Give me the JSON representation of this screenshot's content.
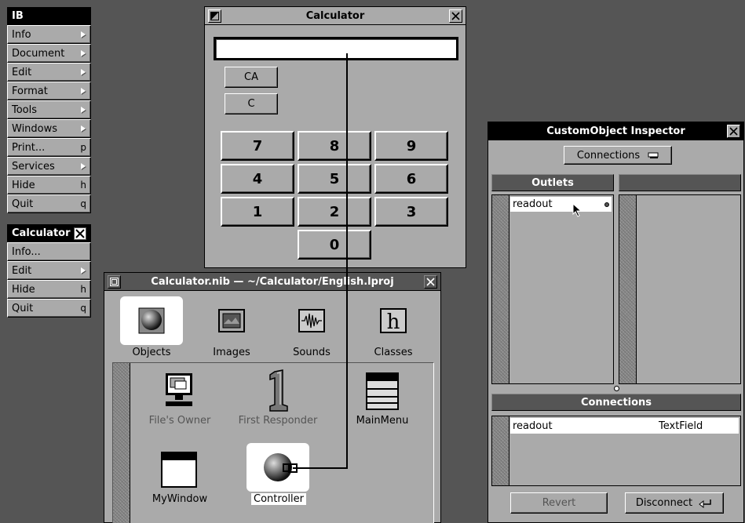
{
  "ib_menu": {
    "title": "IB",
    "items": [
      {
        "label": "Info",
        "key": "",
        "submenu": true
      },
      {
        "label": "Document",
        "key": "",
        "submenu": true
      },
      {
        "label": "Edit",
        "key": "",
        "submenu": true
      },
      {
        "label": "Format",
        "key": "",
        "submenu": true
      },
      {
        "label": "Tools",
        "key": "",
        "submenu": true
      },
      {
        "label": "Windows",
        "key": "",
        "submenu": true
      },
      {
        "label": "Print...",
        "key": "p",
        "submenu": false
      },
      {
        "label": "Services",
        "key": "",
        "submenu": true
      },
      {
        "label": "Hide",
        "key": "h",
        "submenu": false
      },
      {
        "label": "Quit",
        "key": "q",
        "submenu": false
      }
    ]
  },
  "calc_menu": {
    "title": "Calculator",
    "items": [
      {
        "label": "Info...",
        "key": "",
        "submenu": false
      },
      {
        "label": "Edit",
        "key": "",
        "submenu": true
      },
      {
        "label": "Hide",
        "key": "h",
        "submenu": false
      },
      {
        "label": "Quit",
        "key": "q",
        "submenu": false
      }
    ]
  },
  "calculator_window": {
    "title": "Calculator",
    "display_value": "",
    "small_buttons": [
      "CA",
      "C"
    ],
    "digits": [
      "7",
      "8",
      "9",
      "4",
      "5",
      "6",
      "1",
      "2",
      "3",
      "0"
    ]
  },
  "nib_window": {
    "title": "Calculator.nib — ~/Calculator/English.lproj",
    "tabs": [
      {
        "label": "Objects",
        "icon": "sphere-icon",
        "selected": true
      },
      {
        "label": "Images",
        "icon": "image-icon",
        "selected": false
      },
      {
        "label": "Sounds",
        "icon": "waveform-icon",
        "selected": false
      },
      {
        "label": "Classes",
        "icon": "classes-h-icon",
        "selected": false
      }
    ],
    "objects": [
      {
        "label": "File's Owner",
        "icon": "computer-icon",
        "disabled": true
      },
      {
        "label": "First Responder",
        "icon": "first-responder-icon",
        "disabled": true
      },
      {
        "label": "MainMenu",
        "icon": "menu-icon",
        "disabled": false
      },
      {
        "label": "MyWindow",
        "icon": "window-icon",
        "disabled": false
      },
      {
        "label": "Controller",
        "icon": "sphere-icon",
        "disabled": false,
        "selected": true
      }
    ]
  },
  "inspector": {
    "title": "CustomObject Inspector",
    "popup_value": "Connections",
    "outlets_header": "Outlets",
    "outlets": [
      "readout"
    ],
    "connections_header": "Connections",
    "connections": [
      {
        "name": "readout",
        "target": "TextField"
      }
    ],
    "revert_label": "Revert",
    "disconnect_label": "Disconnect"
  },
  "colors": {
    "workspace": "#555555",
    "panel": "#aaaaaa",
    "dark": "#000000",
    "highlight": "#ffffff"
  }
}
